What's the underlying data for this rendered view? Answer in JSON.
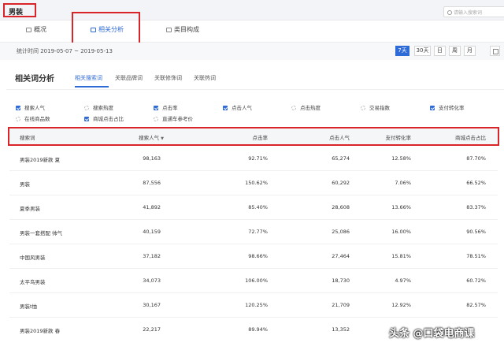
{
  "header": {
    "category_title": "男装",
    "search_placeholder": "请输入搜索词"
  },
  "nav_tabs": [
    {
      "label": "概况"
    },
    {
      "label": "相关分析"
    },
    {
      "label": "类目构成"
    }
  ],
  "date_bar": {
    "range": "统计时间 2019-05-07 ~ 2019-05-13",
    "periods": [
      "7天",
      "30天",
      "日",
      "周",
      "月"
    ]
  },
  "section": {
    "title": "相关词分析",
    "subtabs": [
      "相关搜索词",
      "关联品牌词",
      "关联修饰词",
      "关联热词"
    ]
  },
  "options": [
    {
      "label": "搜索人气",
      "checked": true
    },
    {
      "label": "搜索热度",
      "checked": false
    },
    {
      "label": "点击率",
      "checked": true
    },
    {
      "label": "点击人气",
      "checked": true
    },
    {
      "label": "点击热度",
      "checked": false
    },
    {
      "label": "交易指数",
      "checked": false
    },
    {
      "label": "支付转化率",
      "checked": true
    },
    {
      "label": "在线商品数",
      "checked": false
    },
    {
      "label": "商城点击占比",
      "checked": true
    },
    {
      "label": "直通车参考价",
      "checked": false
    }
  ],
  "table": {
    "headers": [
      "搜索词",
      "搜索人气",
      "点击率",
      "点击人气",
      "支付转化率",
      "商城点击占比"
    ],
    "sort_indicator": "▼",
    "rows": [
      [
        "男装2019新款 夏",
        "98,163",
        "92.71%",
        "65,274",
        "12.58%",
        "87.70%"
      ],
      [
        "男装",
        "87,556",
        "150.62%",
        "60,292",
        "7.06%",
        "66.52%"
      ],
      [
        "夏季男装",
        "41,892",
        "85.40%",
        "28,608",
        "13.66%",
        "83.37%"
      ],
      [
        "男装一套搭配 帅气",
        "40,159",
        "72.77%",
        "25,086",
        "16.00%",
        "90.56%"
      ],
      [
        "中国风男装",
        "37,182",
        "98.66%",
        "27,464",
        "15.81%",
        "78.51%"
      ],
      [
        "太平鸟男装",
        "34,073",
        "106.00%",
        "18,730",
        "4.97%",
        "60.72%"
      ],
      [
        "男装t恤",
        "30,167",
        "120.25%",
        "21,709",
        "12.92%",
        "82.57%"
      ],
      [
        "男装2019新款 春",
        "22,217",
        "89.94%",
        "13,352",
        "",
        ""
      ]
    ]
  },
  "watermark": "头条 @口袋电商课"
}
